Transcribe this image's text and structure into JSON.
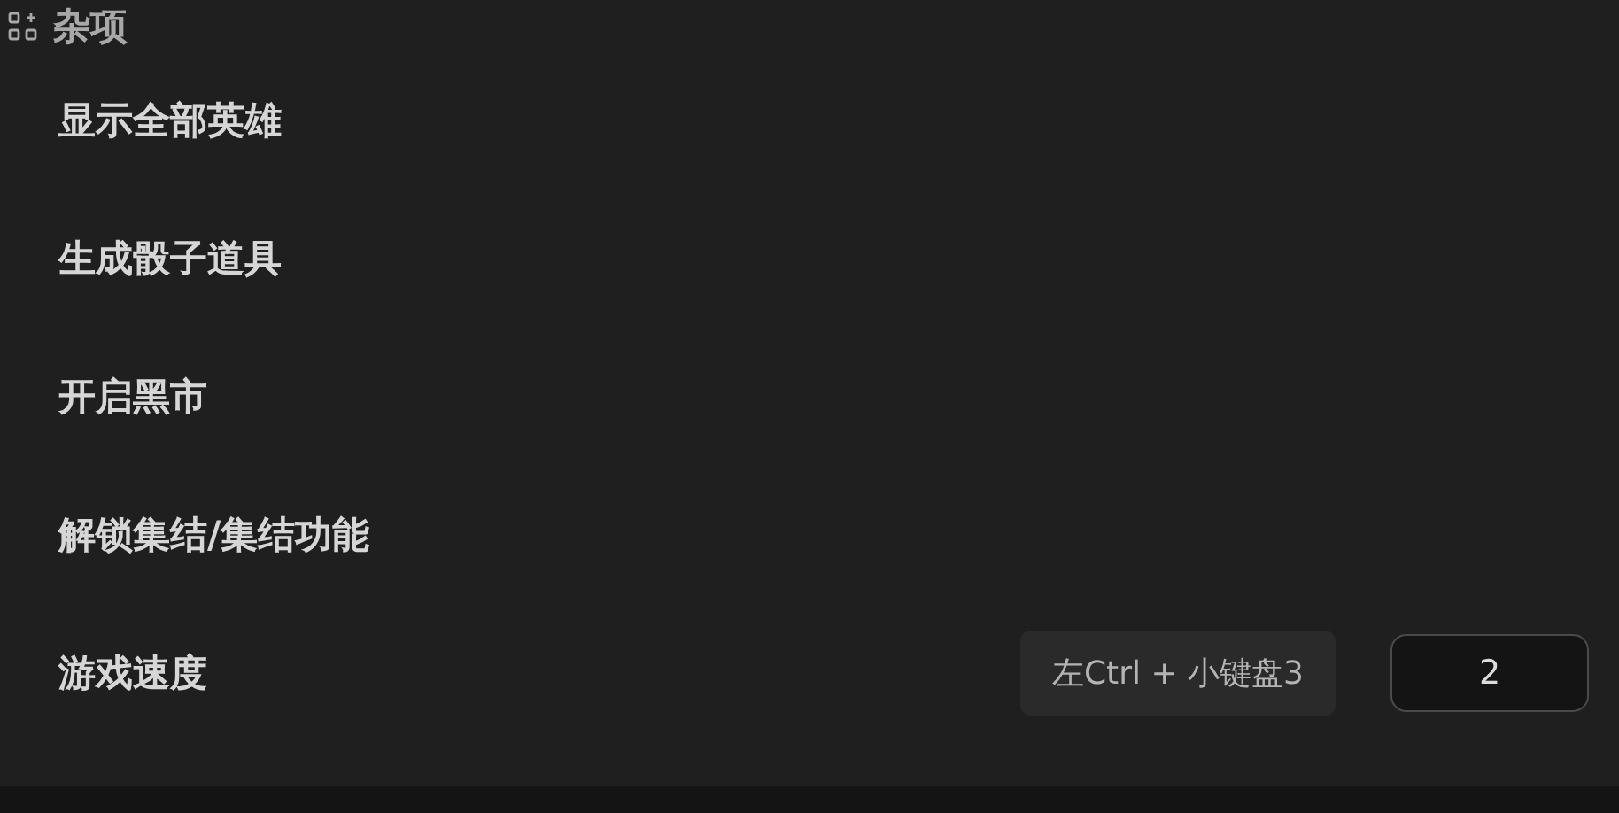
{
  "section": {
    "title": "杂项"
  },
  "items": [
    {
      "kind": "action",
      "label": "显示全部英雄"
    },
    {
      "kind": "action",
      "label": "生成骰子道具"
    },
    {
      "kind": "action",
      "label": "开启黑市"
    },
    {
      "kind": "action",
      "label": "解锁集结/集结功能"
    },
    {
      "kind": "input",
      "label": "游戏速度",
      "shortcut": "左Ctrl + 小键盘3",
      "value": "2"
    }
  ]
}
